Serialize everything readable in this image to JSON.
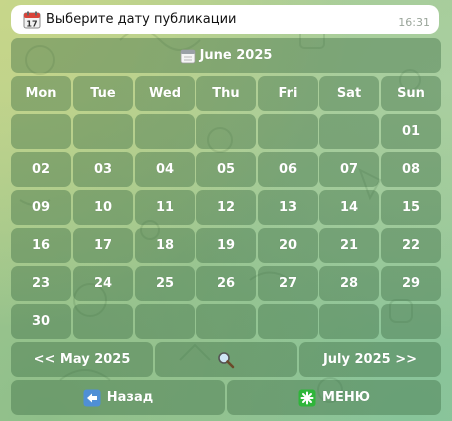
{
  "message": {
    "icon": "calendar-icon",
    "text": "Выберите дату публикации",
    "time": "16:31"
  },
  "calendar": {
    "month_label": "June 2025",
    "month_icon": "calendar-icon",
    "weekdays": [
      "Mon",
      "Tue",
      "Wed",
      "Thu",
      "Fri",
      "Sat",
      "Sun"
    ],
    "weeks": [
      [
        "",
        "",
        "",
        "",
        "",
        "",
        "01"
      ],
      [
        "02",
        "03",
        "04",
        "05",
        "06",
        "07",
        "08"
      ],
      [
        "09",
        "10",
        "11",
        "12",
        "13",
        "14",
        "15"
      ],
      [
        "16",
        "17",
        "18",
        "19",
        "20",
        "21",
        "22"
      ],
      [
        "23",
        "24",
        "25",
        "26",
        "27",
        "28",
        "29"
      ],
      [
        "30",
        "",
        "",
        "",
        "",
        "",
        ""
      ]
    ],
    "prev_label": "<< May 2025",
    "search_icon": "magnifier-icon",
    "next_label": "July 2025 >>"
  },
  "footer": {
    "back_icon": "left-arrow-icon",
    "back_label": "Назад",
    "menu_icon": "asterisk-icon",
    "menu_label": "МЕНЮ"
  },
  "colors": {
    "button_bg": "#3e6e44",
    "message_bg": "#ffffff",
    "menu_icon_bg": "#2fb53a",
    "back_icon_bg": "#4f8fd6"
  }
}
